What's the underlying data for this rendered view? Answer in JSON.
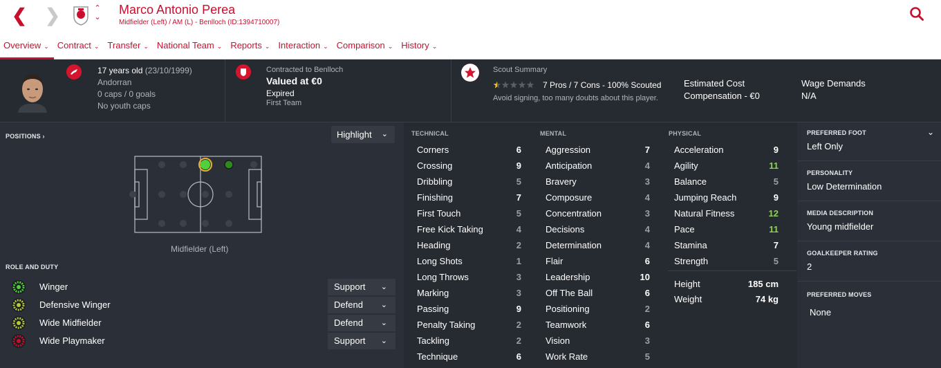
{
  "header": {
    "name": "Marco Antonio Perea",
    "subtitle": "Midfielder (Left) / AM (L) - Benlloch (ID:1394710007)",
    "tabs": [
      {
        "label": "Overview"
      },
      {
        "label": "Contract"
      },
      {
        "label": "Transfer"
      },
      {
        "label": "National Team"
      },
      {
        "label": "Reports"
      },
      {
        "label": "Interaction"
      },
      {
        "label": "Comparison"
      },
      {
        "label": "History"
      }
    ]
  },
  "summary": {
    "age": "17 years old",
    "dob": "(23/10/1999)",
    "nationality": "Andorran",
    "caps": "0 caps / 0 goals",
    "youth_caps": "No youth caps",
    "contract_label": "Contracted to Benlloch",
    "value": "Valued at €0",
    "contract_status": "Expired",
    "squad": "First Team",
    "scout_label": "Scout Summary",
    "scout_rating_stars": 0.5,
    "scout_pros_cons": "7 Pros / 7 Cons - 100% Scouted",
    "scout_advice": "Avoid signing, too many doubts about this player.",
    "estimated_cost_label": "Estimated Cost",
    "estimated_cost_value": "Compensation - €0",
    "wage_label": "Wage Demands",
    "wage_value": "N/A"
  },
  "positions": {
    "header": "POSITIONS",
    "dropdown": "Highlight",
    "label": "Midfielder (Left)"
  },
  "roles": {
    "header": "ROLE AND DUTY",
    "items": [
      {
        "name": "Winger",
        "duty": "Support",
        "color": "#4fd13a"
      },
      {
        "name": "Defensive Winger",
        "duty": "Defend",
        "color": "#b5c93a"
      },
      {
        "name": "Wide Midfielder",
        "duty": "Defend",
        "color": "#b5c93a"
      },
      {
        "name": "Wide Playmaker",
        "duty": "Support",
        "color": "#c8102e"
      }
    ]
  },
  "attributes": {
    "technical": {
      "header": "TECHNICAL",
      "items": [
        {
          "name": "Corners",
          "value": "6"
        },
        {
          "name": "Crossing",
          "value": "9"
        },
        {
          "name": "Dribbling",
          "value": "5"
        },
        {
          "name": "Finishing",
          "value": "7"
        },
        {
          "name": "First Touch",
          "value": "5"
        },
        {
          "name": "Free Kick Taking",
          "value": "4"
        },
        {
          "name": "Heading",
          "value": "2"
        },
        {
          "name": "Long Shots",
          "value": "1"
        },
        {
          "name": "Long Throws",
          "value": "3"
        },
        {
          "name": "Marking",
          "value": "3"
        },
        {
          "name": "Passing",
          "value": "9"
        },
        {
          "name": "Penalty Taking",
          "value": "2"
        },
        {
          "name": "Tackling",
          "value": "2"
        },
        {
          "name": "Technique",
          "value": "6"
        }
      ]
    },
    "mental": {
      "header": "MENTAL",
      "items": [
        {
          "name": "Aggression",
          "value": "7"
        },
        {
          "name": "Anticipation",
          "value": "4"
        },
        {
          "name": "Bravery",
          "value": "3"
        },
        {
          "name": "Composure",
          "value": "4"
        },
        {
          "name": "Concentration",
          "value": "3"
        },
        {
          "name": "Decisions",
          "value": "4"
        },
        {
          "name": "Determination",
          "value": "4"
        },
        {
          "name": "Flair",
          "value": "6"
        },
        {
          "name": "Leadership",
          "value": "10"
        },
        {
          "name": "Off The Ball",
          "value": "6"
        },
        {
          "name": "Positioning",
          "value": "2"
        },
        {
          "name": "Teamwork",
          "value": "6"
        },
        {
          "name": "Vision",
          "value": "3"
        },
        {
          "name": "Work Rate",
          "value": "5"
        }
      ]
    },
    "physical": {
      "header": "PHYSICAL",
      "items": [
        {
          "name": "Acceleration",
          "value": "9"
        },
        {
          "name": "Agility",
          "value": "11"
        },
        {
          "name": "Balance",
          "value": "5"
        },
        {
          "name": "Jumping Reach",
          "value": "9"
        },
        {
          "name": "Natural Fitness",
          "value": "12"
        },
        {
          "name": "Pace",
          "value": "11"
        },
        {
          "name": "Stamina",
          "value": "7"
        },
        {
          "name": "Strength",
          "value": "5"
        }
      ],
      "height_label": "Height",
      "height_value": "185 cm",
      "weight_label": "Weight",
      "weight_value": "74 kg"
    }
  },
  "info": {
    "preferred_foot_label": "PREFERRED FOOT",
    "preferred_foot": "Left Only",
    "personality_label": "PERSONALITY",
    "personality": "Low Determination",
    "media_label": "MEDIA DESCRIPTION",
    "media": "Young midfielder",
    "gk_label": "GOALKEEPER RATING",
    "gk": "2",
    "moves_label": "PREFERRED MOVES",
    "moves": "None"
  },
  "colors": {
    "accent": "#c8102e",
    "green": "#8fd15a"
  }
}
